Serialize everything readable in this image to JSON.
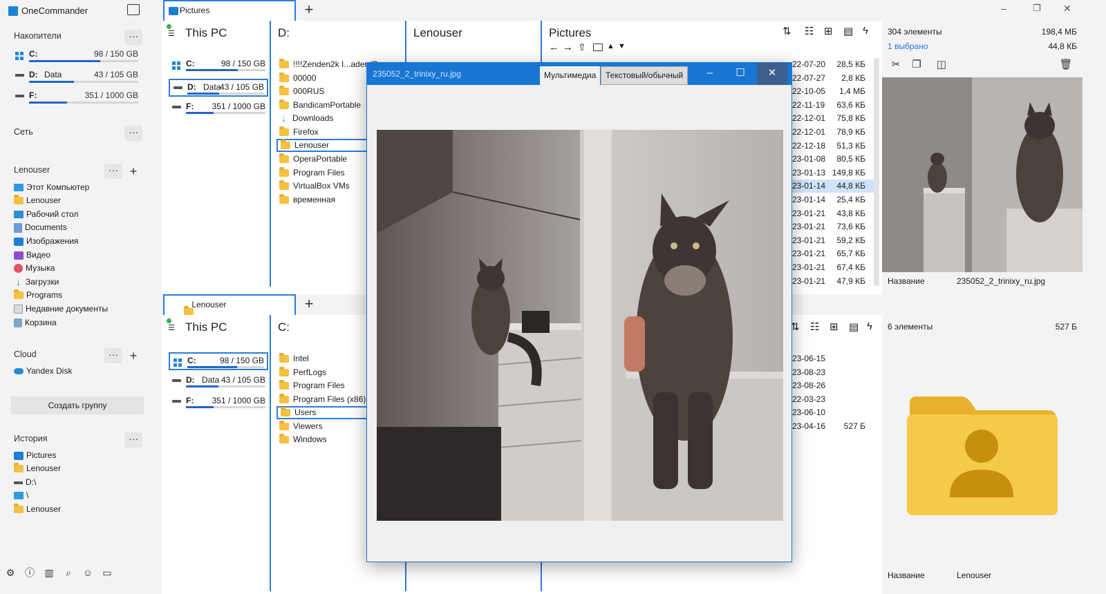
{
  "app": {
    "title": "OneCommander"
  },
  "sidebar": {
    "drives_title": "Накопители",
    "drives": [
      {
        "letter": "C:",
        "name": "",
        "size": "98 / 150 GB",
        "used": 0.65
      },
      {
        "letter": "D:",
        "name": "Data",
        "size": "43 / 105 GB",
        "used": 0.41
      },
      {
        "letter": "F:",
        "name": "",
        "size": "351 / 1000 GB",
        "used": 0.35
      }
    ],
    "network_title": "Сеть",
    "user_title": "Lenouser",
    "user_items": [
      "Этот Компьютер",
      "Lenouser",
      "Рабочий стол",
      "Documents",
      "Изображения",
      "Видео",
      "Музыка",
      "Загрузки",
      "Programs",
      "Недавние документы",
      "Корзина"
    ],
    "cloud_title": "Cloud",
    "cloud_items": [
      "Yandex Disk"
    ],
    "create_group": "Создать группу",
    "history_title": "История",
    "history_items": [
      "Pictures",
      "Lenouser",
      "D:\\",
      "\\",
      "Lenouser"
    ],
    "dots": "···",
    "plus": "+"
  },
  "top_pane": {
    "tab": "Pictures",
    "col1_title": "This PC",
    "col2_title": "D:",
    "col3_title": "Lenouser",
    "col4_title": "Pictures",
    "d_items": [
      "!!!!Zenden2k I...ader (P",
      "00000",
      "000RUS",
      "BandicamPortable",
      "Downloads",
      "Firefox",
      "Lenouser",
      "OperaPortable",
      "Program Files",
      "VirtualBox VMs",
      "временная"
    ],
    "rows": [
      {
        "date": "22-07-20",
        "size": "28,5 КБ"
      },
      {
        "date": "22-07-27",
        "size": "2,8 КБ"
      },
      {
        "date": "22-10-05",
        "size": "1,4 МБ"
      },
      {
        "date": "22-11-19",
        "size": "63,6 КБ"
      },
      {
        "date": "22-12-01",
        "size": "75,8 КБ"
      },
      {
        "date": "22-12-01",
        "size": "78,9 КБ"
      },
      {
        "date": "22-12-18",
        "size": "51,3 КБ"
      },
      {
        "date": "23-01-08",
        "size": "80,5 КБ"
      },
      {
        "date": "23-01-13",
        "size": "149,8 КБ"
      },
      {
        "date": "23-01-14",
        "size": "44,8 КБ"
      },
      {
        "date": "23-01-14",
        "size": "25,4 КБ"
      },
      {
        "date": "23-01-21",
        "size": "43,8 КБ"
      },
      {
        "date": "23-01-21",
        "size": "73,6 КБ"
      },
      {
        "date": "23-01-21",
        "size": "59,2 КБ"
      },
      {
        "date": "23-01-21",
        "size": "65,7 КБ"
      },
      {
        "date": "23-01-21",
        "size": "67,4 КБ"
      },
      {
        "date": "23-01-21",
        "size": "47,9 КБ"
      }
    ]
  },
  "bottom_pane": {
    "tab": "Lenouser",
    "col1_title": "This PC",
    "col2_title": "C:",
    "c_items": [
      "Intel",
      "PerfLogs",
      "Program Files",
      "Program Files (x86)",
      "Users",
      "Viewers",
      "Windows"
    ],
    "rows": [
      {
        "date": "23-06-15",
        "size": ""
      },
      {
        "date": "23-08-23",
        "size": ""
      },
      {
        "date": "23-08-26",
        "size": ""
      },
      {
        "date": "22-03-23",
        "size": ""
      },
      {
        "date": "23-06-10",
        "size": ""
      },
      {
        "date": "23-04-16",
        "size": "527 Б"
      }
    ]
  },
  "viewer": {
    "filename": "235052_2_trinixy_ru.jpg",
    "tab_media": "Мультимедиа",
    "tab_text": "Текстовый/обычный",
    "min": "–",
    "max": "☐",
    "close": "✕"
  },
  "right_top": {
    "count": "304 элементы",
    "total_size": "198,4 МБ",
    "selected": "1 выбрано",
    "selected_size": "44,8 КБ",
    "name_label": "Название",
    "name_value": "235052_2_trinixy_ru.jpg"
  },
  "right_bottom": {
    "count": "6 элементы",
    "total_size": "527 Б",
    "name_label": "Название",
    "name_value": "Lenouser"
  },
  "colors": {
    "accent": "#2e7bd8",
    "titlebar": "#1976d2",
    "folder": "#f4c242"
  }
}
